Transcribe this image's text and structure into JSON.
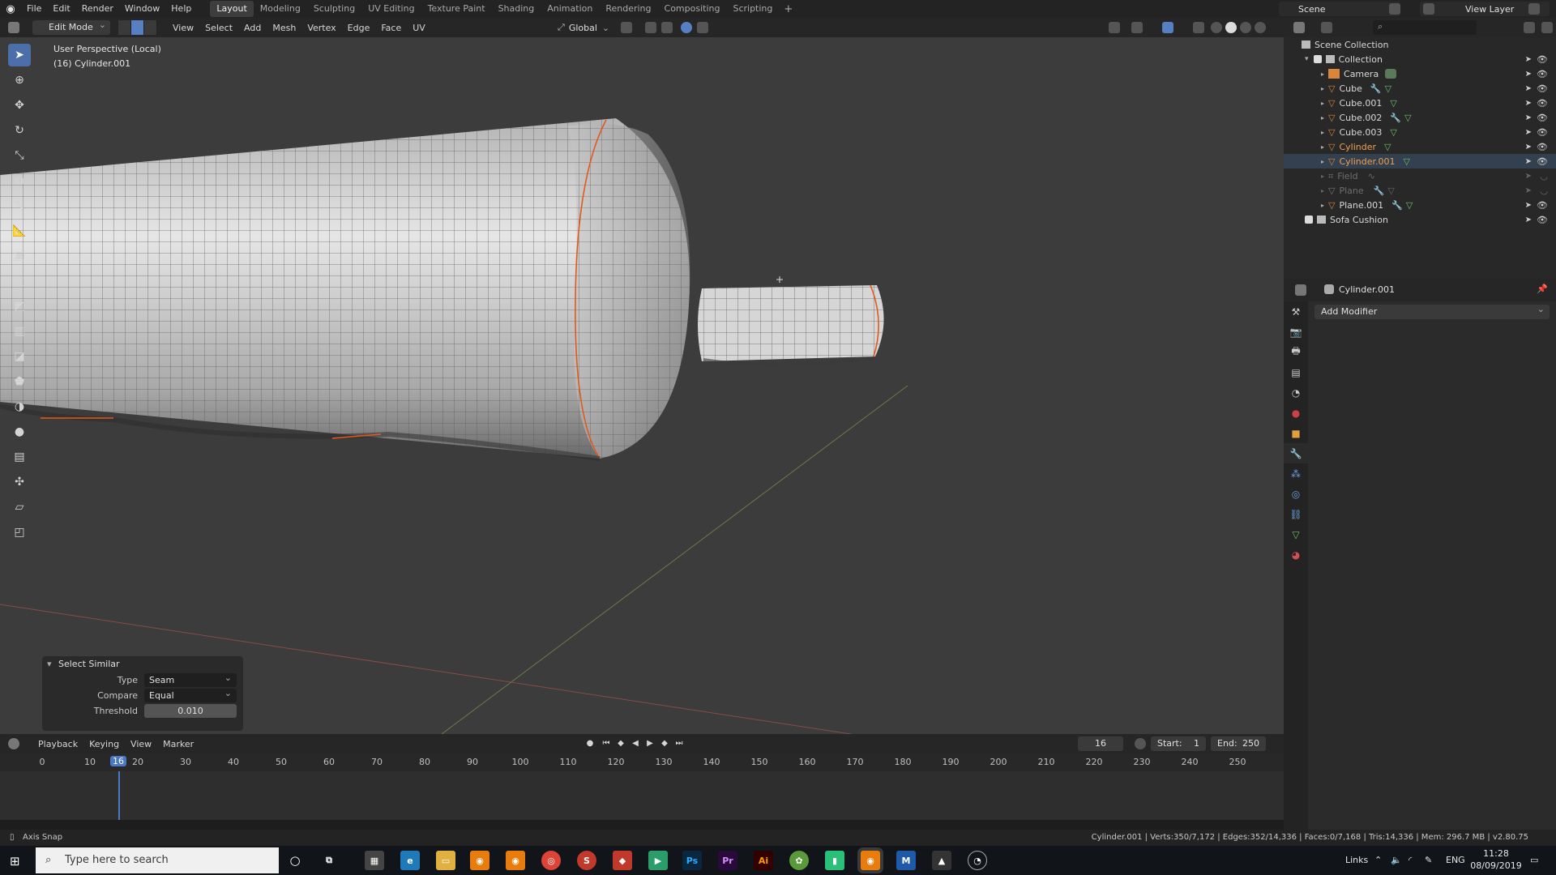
{
  "menubar": {
    "items": [
      "File",
      "Edit",
      "Render",
      "Window",
      "Help"
    ],
    "workspaces": [
      "Layout",
      "Modeling",
      "Sculpting",
      "UV Editing",
      "Texture Paint",
      "Shading",
      "Animation",
      "Rendering",
      "Compositing",
      "Scripting"
    ],
    "active_workspace": "Layout",
    "add_tab": "+",
    "scene": "Scene",
    "view_layer": "View Layer"
  },
  "viewport_header": {
    "mode": "Edit Mode",
    "menus": [
      "View",
      "Select",
      "Add",
      "Mesh",
      "Vertex",
      "Edge",
      "Face",
      "UV"
    ],
    "orientation": "Global"
  },
  "viewport": {
    "perspective_label": "User Perspective (Local)",
    "object_label": "(16) Cylinder.001"
  },
  "operator_panel": {
    "title": "Select Similar",
    "type_label": "Type",
    "type_value": "Seam",
    "compare_label": "Compare",
    "compare_value": "Equal",
    "threshold_label": "Threshold",
    "threshold_value": "0.010"
  },
  "timeline": {
    "menus": [
      "Playback",
      "Keying",
      "View",
      "Marker"
    ],
    "current_frame": "16",
    "start_label": "Start:",
    "start_value": "1",
    "end_label": "End:",
    "end_value": "250",
    "ticks": [
      "0",
      "10",
      "20",
      "30",
      "40",
      "50",
      "60",
      "70",
      "80",
      "90",
      "100",
      "110",
      "120",
      "130",
      "140",
      "150",
      "160",
      "170",
      "180",
      "190",
      "200",
      "210",
      "220",
      "230",
      "240",
      "250"
    ]
  },
  "status": {
    "left": "Axis Snap",
    "right": "Cylinder.001 | Verts:350/7,172 | Edges:352/14,336 | Faces:0/7,168 | Tris:14,336 | Mem: 296.7 MB | v2.80.75"
  },
  "outliner": {
    "root": "Scene Collection",
    "collection": "Collection",
    "items": [
      {
        "name": "Camera",
        "state": "normal"
      },
      {
        "name": "Cube",
        "state": "normal"
      },
      {
        "name": "Cube.001",
        "state": "normal"
      },
      {
        "name": "Cube.002",
        "state": "normal"
      },
      {
        "name": "Cube.003",
        "state": "normal"
      },
      {
        "name": "Cylinder",
        "state": "active"
      },
      {
        "name": "Cylinder.001",
        "state": "active"
      },
      {
        "name": "Field",
        "state": "dim"
      },
      {
        "name": "Plane",
        "state": "dim"
      },
      {
        "name": "Plane.001",
        "state": "normal"
      }
    ],
    "extra_collection": "Sofa Cushion"
  },
  "properties": {
    "object_name": "Cylinder.001",
    "add_modifier": "Add Modifier"
  },
  "taskbar": {
    "search_placeholder": "Type here to search",
    "links": "Links",
    "lang": "ENG",
    "time": "11:28",
    "date": "08/09/2019"
  }
}
